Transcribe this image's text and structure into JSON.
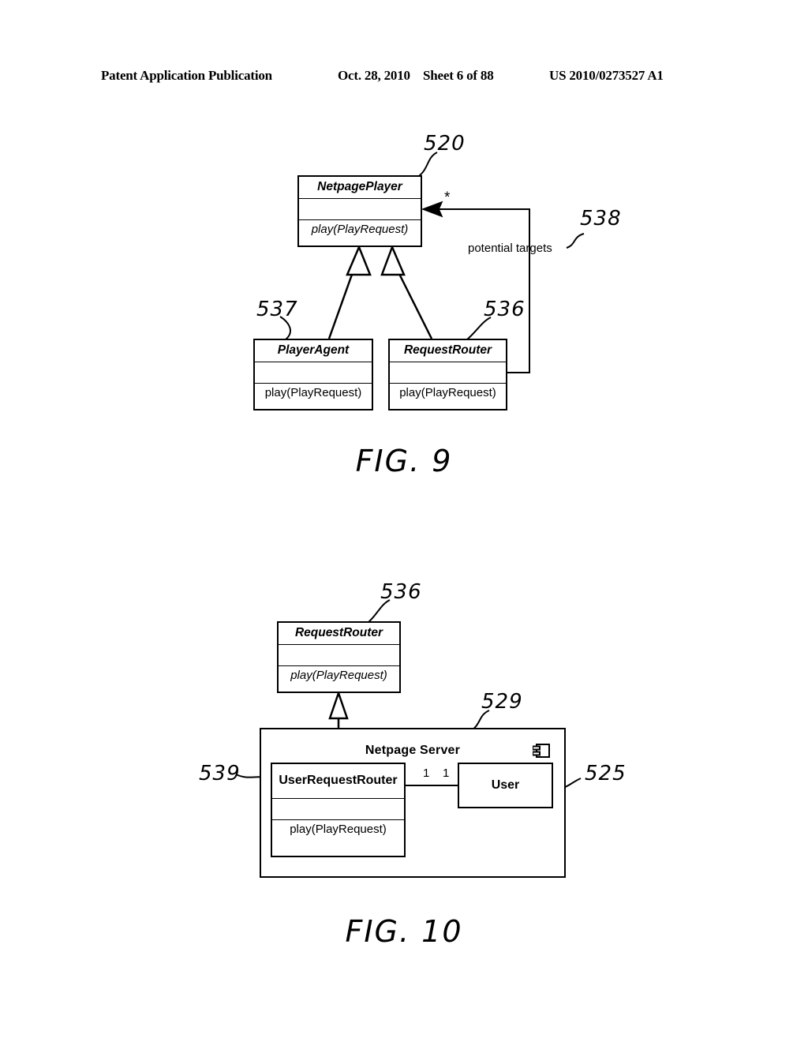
{
  "header": {
    "publication": "Patent Application Publication",
    "date": "Oct. 28, 2010",
    "sheet": "Sheet 6 of 88",
    "number": "US 2010/0273527 A1"
  },
  "figures": [
    {
      "caption": "FIG. 9",
      "classes": [
        {
          "name": "NetpagePlayer",
          "abstract": true,
          "attributes": "",
          "operations": "play(PlayRequest)",
          "operations_abstract": true,
          "ref": "520"
        },
        {
          "name": "PlayerAgent",
          "abstract": true,
          "attributes": "",
          "operations": "play(PlayRequest)",
          "operations_abstract": false,
          "ref": "537"
        },
        {
          "name": "RequestRouter",
          "abstract": true,
          "attributes": "",
          "operations": "play(PlayRequest)",
          "operations_abstract": false,
          "ref": "536"
        }
      ],
      "associations": [
        {
          "label": "potential targets",
          "ref": "538",
          "source": "RequestRouter",
          "target": "NetpagePlayer",
          "target_multiplicity": "*"
        }
      ],
      "generalizations": [
        {
          "from": "PlayerAgent",
          "to": "NetpagePlayer"
        },
        {
          "from": "RequestRouter",
          "to": "NetpagePlayer"
        }
      ]
    },
    {
      "caption": "FIG. 10",
      "classes": [
        {
          "name": "RequestRouter",
          "abstract": true,
          "attributes": "",
          "operations": "play(PlayRequest)",
          "operations_abstract": true,
          "ref": "536"
        },
        {
          "name": "UserRequestRouter",
          "abstract": false,
          "attributes": "",
          "operations": "play(PlayRequest)",
          "operations_abstract": false,
          "ref": "539"
        }
      ],
      "package": {
        "name": "Netpage Server",
        "ref": "529",
        "icon": "component-icon"
      },
      "plain_boxes": [
        {
          "name": "User",
          "ref": "525"
        }
      ],
      "associations": [
        {
          "source": "UserRequestRouter",
          "target": "User",
          "source_multiplicity": "1",
          "target_multiplicity": "1"
        }
      ],
      "generalizations": [
        {
          "from": "UserRequestRouter",
          "to": "RequestRouter"
        }
      ]
    }
  ]
}
